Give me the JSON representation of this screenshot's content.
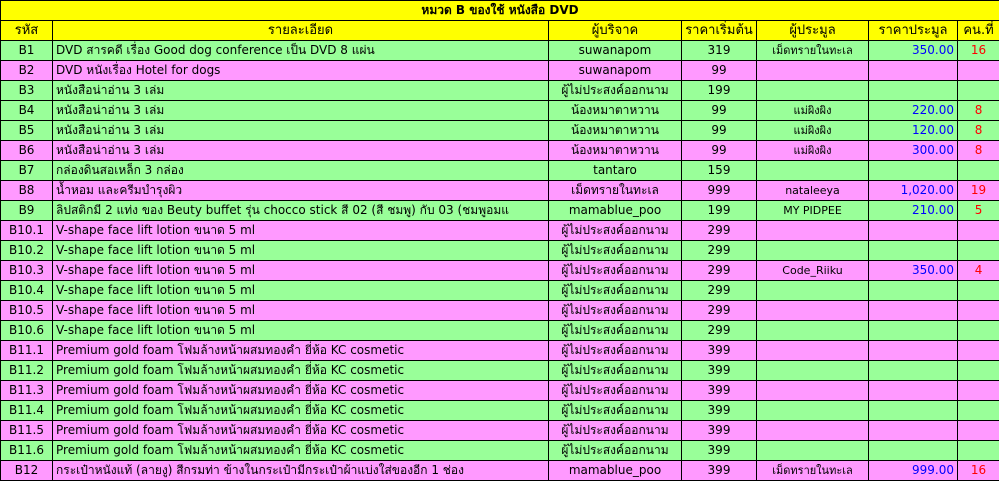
{
  "title": "หมวด B ของใช้ หนังสือ DVD",
  "headers": [
    "รหัส",
    "รายละเอียด",
    "ผู้บริจาค",
    "ราคาเริ่มต้น",
    "ผู้ประมูล",
    "ราคาประมูล",
    "คน.ที่"
  ],
  "rows": [
    {
      "code": "B1",
      "detail": "DVD สารคดี เรื่อง Good dog conference เป็น DVD 8 แผ่น",
      "donor": "suwanapom",
      "start": "319",
      "bidder": "เม็ดทรายในทะเล",
      "price": "350.00",
      "count": "16",
      "color": "green"
    },
    {
      "code": "B2",
      "detail": "DVD หนังเรื่อง Hotel for dogs",
      "donor": "suwanapom",
      "start": "99",
      "bidder": "",
      "price": "",
      "count": "",
      "color": "pink"
    },
    {
      "code": "B3",
      "detail": "หนังสือน่าอ่าน 3 เล่ม",
      "donor": "ผู้ไม่ประสงค์ออกนาม",
      "start": "199",
      "bidder": "",
      "price": "",
      "count": "",
      "color": "green"
    },
    {
      "code": "B4",
      "detail": "หนังสือน่าอ่าน 3 เล่ม",
      "donor": "น้องหมาตาหวาน",
      "start": "99",
      "bidder": "แม่ผิงผิง",
      "price": "220.00",
      "count": "8",
      "color": "green"
    },
    {
      "code": "B5",
      "detail": "หนังสือน่าอ่าน 3 เล่ม",
      "donor": "น้องหมาตาหวาน",
      "start": "99",
      "bidder": "แม่ผิงผิง",
      "price": "120.00",
      "count": "8",
      "color": "green"
    },
    {
      "code": "B6",
      "detail": "หนังสือน่าอ่าน 3 เล่ม",
      "donor": "น้องหมาตาหวาน",
      "start": "99",
      "bidder": "แม่ผิงผิง",
      "price": "300.00",
      "count": "8",
      "color": "pink"
    },
    {
      "code": "B7",
      "detail": "กล่องดินสอเหล็ก 3 กล่อง",
      "donor": "tantaro",
      "start": "159",
      "bidder": "",
      "price": "",
      "count": "",
      "color": "green"
    },
    {
      "code": "B8",
      "detail": "น้ำหอม และครีมบำรุงผิว",
      "donor": "เม็ดทรายในทะเล",
      "start": "999",
      "bidder": "nataleeya",
      "price": "1,020.00",
      "count": "19",
      "color": "pink"
    },
    {
      "code": "B9",
      "detail": "ลิปสติกมี 2 แท่ง ของ Beuty buffet รุ่น chocco stick สี 02 (สี ชมพู) กับ 03 (ชมพูอมแ",
      "donor": "mamablue_poo",
      "start": "199",
      "bidder": "MY PIDPEE",
      "price": "210.00",
      "count": "5",
      "color": "green"
    },
    {
      "code": "B10.1",
      "detail": "V-shape face lift lotion ขนาด 5 ml",
      "donor": "ผู้ไม่ประสงค์ออกนาม",
      "start": "299",
      "bidder": "",
      "price": "",
      "count": "",
      "color": "pink"
    },
    {
      "code": "B10.2",
      "detail": "V-shape face lift lotion ขนาด 5 ml",
      "donor": "ผู้ไม่ประสงค์ออกนาม",
      "start": "299",
      "bidder": "",
      "price": "",
      "count": "",
      "color": "green"
    },
    {
      "code": "B10.3",
      "detail": "V-shape face lift lotion ขนาด 5 ml",
      "donor": "ผู้ไม่ประสงค์ออกนาม",
      "start": "299",
      "bidder": "Code_Riiku",
      "price": "350.00",
      "count": "4",
      "color": "pink"
    },
    {
      "code": "B10.4",
      "detail": "V-shape face lift lotion ขนาด 5 ml",
      "donor": "ผู้ไม่ประสงค์ออกนาม",
      "start": "299",
      "bidder": "",
      "price": "",
      "count": "",
      "color": "green"
    },
    {
      "code": "B10.5",
      "detail": "V-shape face lift lotion ขนาด 5 ml",
      "donor": "ผู้ไม่ประสงค์ออกนาม",
      "start": "299",
      "bidder": "",
      "price": "",
      "count": "",
      "color": "pink"
    },
    {
      "code": "B10.6",
      "detail": "V-shape face lift lotion ขนาด 5 ml",
      "donor": "ผู้ไม่ประสงค์ออกนาม",
      "start": "299",
      "bidder": "",
      "price": "",
      "count": "",
      "color": "green"
    },
    {
      "code": "B11.1",
      "detail": "Premium gold foam โฟมล้างหน้าผสมทองคำ ยี่ห้อ KC cosmetic",
      "donor": "ผู้ไม่ประสงค์ออกนาม",
      "start": "399",
      "bidder": "",
      "price": "",
      "count": "",
      "color": "pink"
    },
    {
      "code": "B11.2",
      "detail": "Premium gold foam โฟมล้างหน้าผสมทองคำ ยี่ห้อ KC cosmetic",
      "donor": "ผู้ไม่ประสงค์ออกนาม",
      "start": "399",
      "bidder": "",
      "price": "",
      "count": "",
      "color": "green"
    },
    {
      "code": "B11.3",
      "detail": "Premium gold foam โฟมล้างหน้าผสมทองคำ ยี่ห้อ KC cosmetic",
      "donor": "ผู้ไม่ประสงค์ออกนาม",
      "start": "399",
      "bidder": "",
      "price": "",
      "count": "",
      "color": "pink"
    },
    {
      "code": "B11.4",
      "detail": "Premium gold foam โฟมล้างหน้าผสมทองคำ ยี่ห้อ KC cosmetic",
      "donor": "ผู้ไม่ประสงค์ออกนาม",
      "start": "399",
      "bidder": "",
      "price": "",
      "count": "",
      "color": "green"
    },
    {
      "code": "B11.5",
      "detail": "Premium gold foam โฟมล้างหน้าผสมทองคำ ยี่ห้อ KC cosmetic",
      "donor": "ผู้ไม่ประสงค์ออกนาม",
      "start": "399",
      "bidder": "",
      "price": "",
      "count": "",
      "color": "pink"
    },
    {
      "code": "B11.6",
      "detail": "Premium gold foam โฟมล้างหน้าผสมทองคำ ยี่ห้อ KC cosmetic",
      "donor": "ผู้ไม่ประสงค์ออกนาม",
      "start": "399",
      "bidder": "",
      "price": "",
      "count": "",
      "color": "green"
    },
    {
      "code": "B12",
      "detail": "กระเป๋าหนังแท้ (ลายงู) สีกรมท่า ข้างในกระเป๋ามีกระเป๋าผ้าแบ่งใส่ของอีก 1 ช่อง",
      "donor": "mamablue_poo",
      "start": "399",
      "bidder": "เม็ดทรายในทะเล",
      "price": "999.00",
      "count": "16",
      "color": "pink"
    }
  ],
  "colors": {
    "header": "#ffff00",
    "green": "#99ff99",
    "pink": "#ff99ff",
    "price": "#0000ff",
    "count": "#ff0000"
  }
}
